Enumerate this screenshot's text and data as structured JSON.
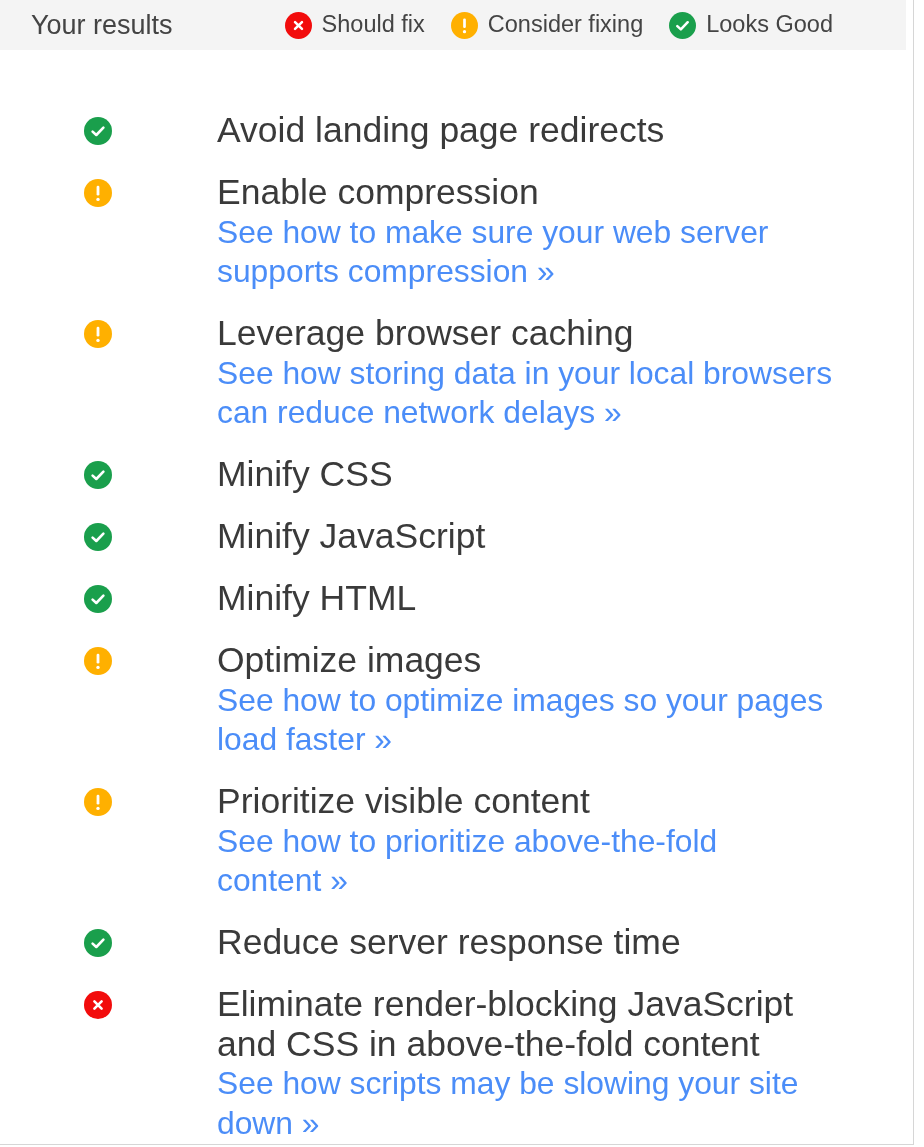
{
  "header": {
    "title": "Your results",
    "legend": [
      {
        "kind": "error",
        "label": "Should fix"
      },
      {
        "kind": "warning",
        "label": "Consider fixing"
      },
      {
        "kind": "pass",
        "label": "Looks Good"
      }
    ]
  },
  "rules": [
    {
      "kind": "pass",
      "title": "Avoid landing page redirects"
    },
    {
      "kind": "warning",
      "title": "Enable compression",
      "link": "See how to make sure your web server supports compression »"
    },
    {
      "kind": "warning",
      "title": "Leverage browser caching",
      "link": "See how storing data in your local browsers can reduce network delays »"
    },
    {
      "kind": "pass",
      "title": "Minify CSS"
    },
    {
      "kind": "pass",
      "title": "Minify JavaScript"
    },
    {
      "kind": "pass",
      "title": "Minify HTML"
    },
    {
      "kind": "warning",
      "title": "Optimize images",
      "link": "See how to optimize images so your pages load faster »"
    },
    {
      "kind": "warning",
      "title": "Prioritize visible content",
      "link": "See how to prioritize above-the-fold content »"
    },
    {
      "kind": "pass",
      "title": "Reduce server response time"
    },
    {
      "kind": "error",
      "title": "Eliminate render-blocking JavaScript and CSS in above-the-fold content",
      "link": "See how scripts may be slowing your site down »"
    }
  ]
}
